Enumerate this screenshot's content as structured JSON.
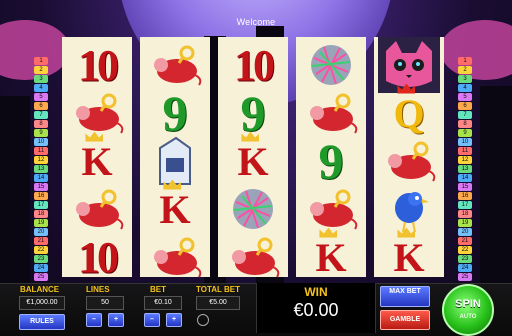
{
  "header": {
    "message": "Welcome"
  },
  "paylines": {
    "left": [
      "1",
      "2",
      "3",
      "4",
      "5",
      "6",
      "7",
      "8",
      "9",
      "10",
      "11",
      "12",
      "13",
      "14",
      "15",
      "16",
      "17",
      "18",
      "19",
      "20",
      "21",
      "22",
      "23",
      "24",
      "25"
    ],
    "right": [
      "1",
      "2",
      "3",
      "4",
      "5",
      "6",
      "7",
      "8",
      "9",
      "10",
      "11",
      "12",
      "13",
      "14",
      "15",
      "16",
      "17",
      "18",
      "19",
      "20",
      "21",
      "22",
      "23",
      "24",
      "25"
    ]
  },
  "reels": [
    [
      "10",
      "mouse",
      "K",
      "mouse",
      "10"
    ],
    [
      "mouse",
      "9",
      "milk",
      "K",
      "mouse"
    ],
    [
      "10",
      "9",
      "K",
      "ball",
      "mouse"
    ],
    [
      "ball",
      "mouse",
      "9",
      "mouse",
      "K"
    ],
    [
      "cat",
      "Q",
      "mouse",
      "bird",
      "K"
    ]
  ],
  "panel": {
    "balance_label": "BALANCE",
    "balance_value": "€1,000.00",
    "rules_label": "RULES",
    "lines_label": "LINES",
    "lines_value": "50",
    "bet_label": "BET",
    "bet_value": "€0.10",
    "total_bet_label": "TOTAL BET",
    "total_bet_value": "€5.00",
    "win_label": "WIN",
    "win_value": "€0.00",
    "max_bet_label": "MAX BET",
    "gamble_label": "GAMBLE",
    "spin_label": "SPIN",
    "auto_label": "AUTO",
    "minus": "–",
    "plus": "+"
  }
}
